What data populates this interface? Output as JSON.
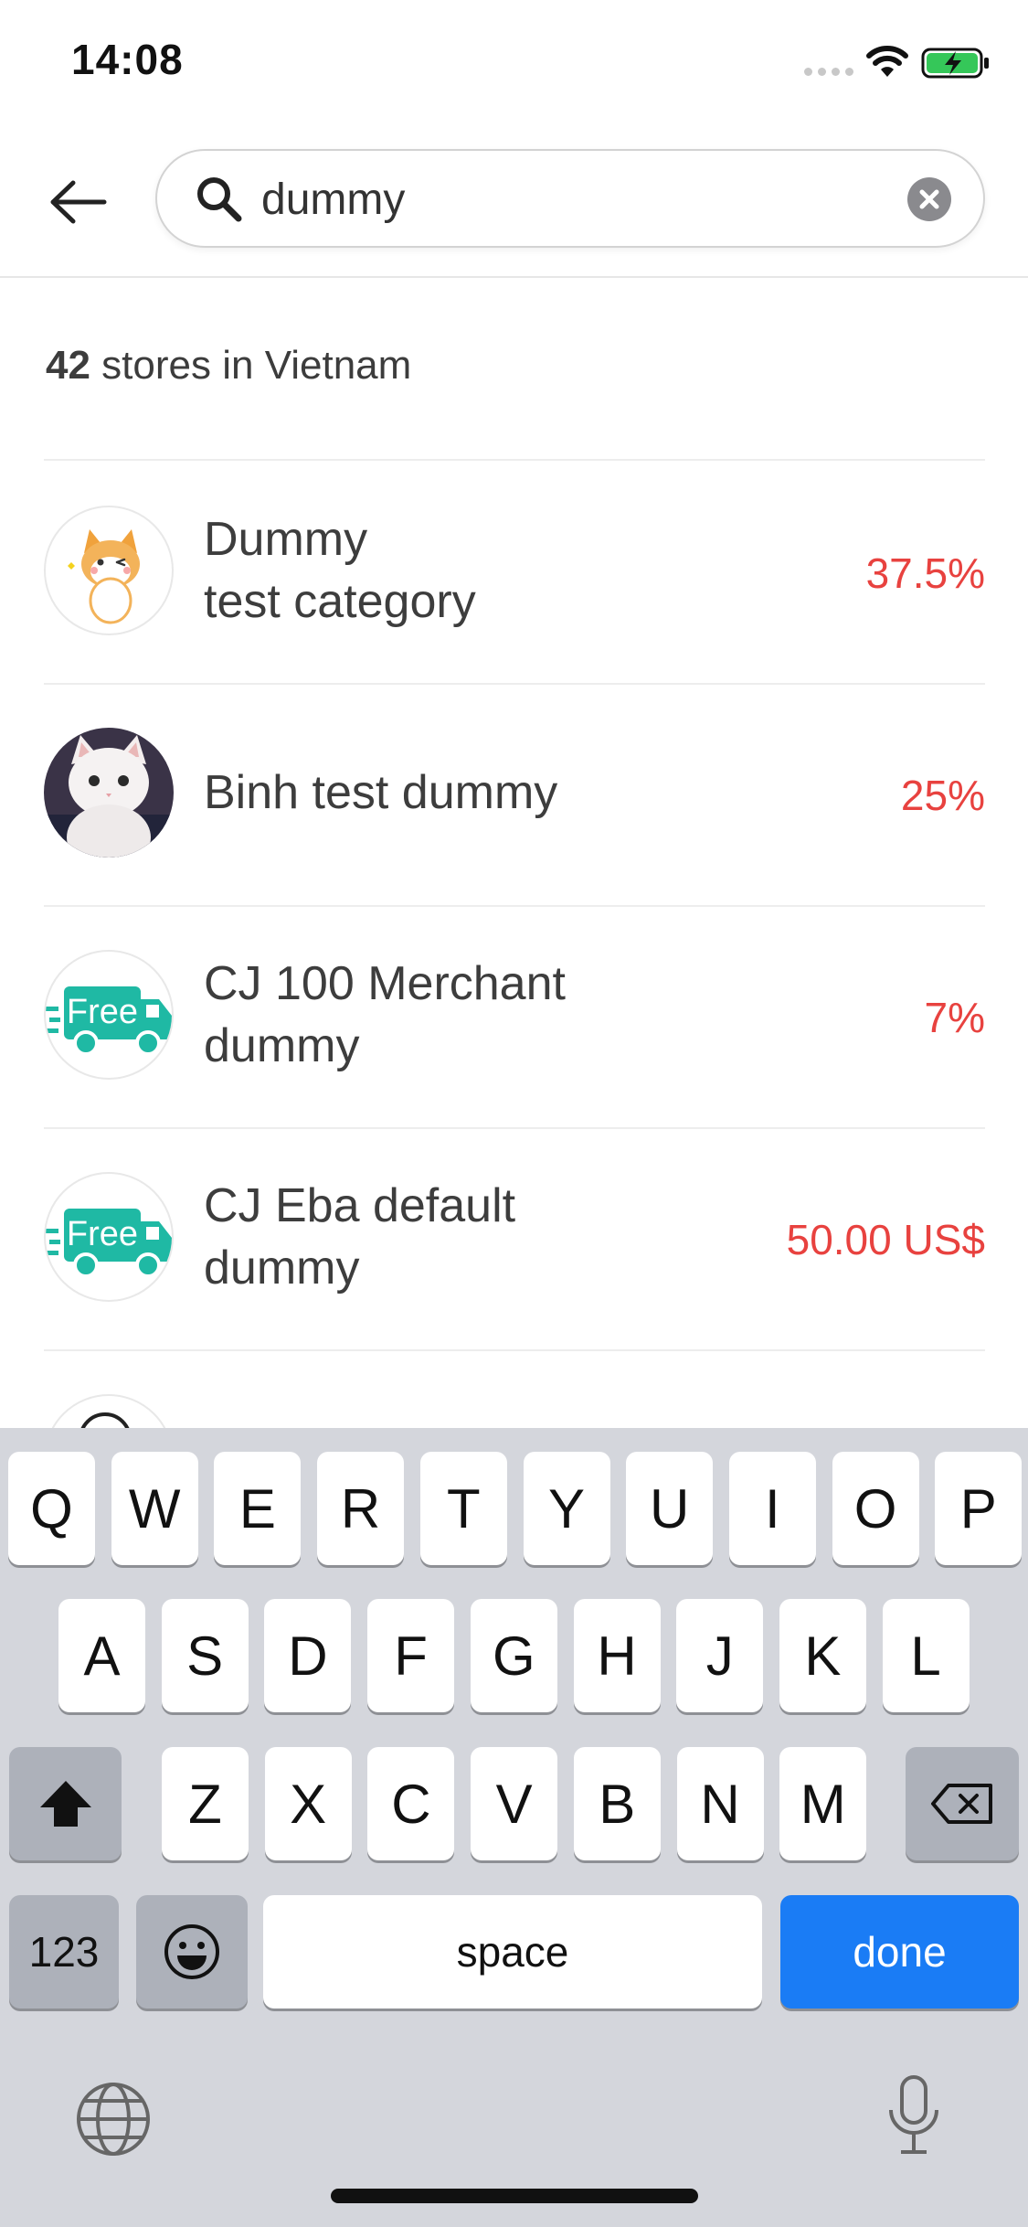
{
  "status_bar": {
    "time": "14:08"
  },
  "search": {
    "value": "dummy"
  },
  "results": {
    "count": "42",
    "label": " stores in Vietnam"
  },
  "stores": [
    {
      "name": "Dummy\ntest category",
      "rate": "37.5%",
      "avatar": "cartoon-cat-avatar"
    },
    {
      "name": "Binh test dummy",
      "rate": "25%",
      "avatar": "white-cat-photo"
    },
    {
      "name": "CJ 100 Merchant\ndummy",
      "rate": "7%",
      "avatar": "free-truck-logo",
      "logo_text": "Free"
    },
    {
      "name": "CJ Eba default\ndummy",
      "rate": "50.00 US$",
      "avatar": "free-truck-logo",
      "logo_text": "Free"
    }
  ],
  "keyboard": {
    "row1": [
      "Q",
      "W",
      "E",
      "R",
      "T",
      "Y",
      "U",
      "I",
      "O",
      "P"
    ],
    "row2": [
      "A",
      "S",
      "D",
      "F",
      "G",
      "H",
      "J",
      "K",
      "L"
    ],
    "row3": [
      "Z",
      "X",
      "C",
      "V",
      "B",
      "N",
      "M"
    ],
    "numbers_label": "123",
    "space_label": "space",
    "done_label": "done"
  },
  "colors": {
    "rate": "#e8423f",
    "accent_blue": "#1a7cf5",
    "truck_teal": "#1fb9a4"
  }
}
